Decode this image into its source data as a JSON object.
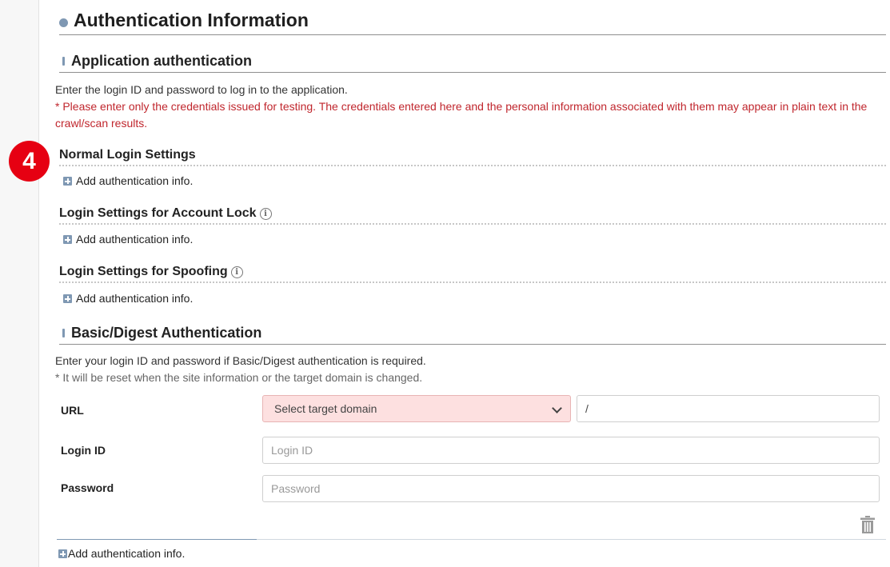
{
  "page": {
    "title": "Authentication Information",
    "step_badge": "4"
  },
  "app_auth": {
    "title": "Application authentication",
    "description": "Enter the login ID and password to log in to the application.",
    "warning": "* Please enter only the credentials issued for testing. The credentials entered here and the personal information associated with them may appear in plain text in the crawl/scan results.",
    "sections": [
      {
        "title": "Normal Login Settings",
        "add_label": "Add authentication info."
      },
      {
        "title": "Login Settings for Account Lock",
        "add_label": "Add authentication info."
      },
      {
        "title": "Login Settings for Spoofing",
        "add_label": "Add authentication info."
      }
    ]
  },
  "basic_auth": {
    "title": "Basic/Digest Authentication",
    "description": "Enter your login ID and password if Basic/Digest authentication is required.",
    "note": "* It will be reset when the site information or the target domain is changed.",
    "url_label": "URL",
    "domain_select_value": "Select target domain",
    "path_value": "/",
    "login_id_label": "Login ID",
    "login_id_placeholder": "Login ID",
    "password_label": "Password",
    "password_placeholder": "Password",
    "add_label": "Add authentication info."
  },
  "icons": {
    "bullet": "circle-bullet-icon",
    "section_marker": "bar-marker-icon",
    "add": "plus-square-icon",
    "info": "info-circle-icon",
    "dropdown": "chevron-down-icon",
    "delete": "trash-icon"
  },
  "colors": {
    "accent": "#7f98b3",
    "warning_text": "#c0262d",
    "badge": "#e60012",
    "select_bg": "#fde0e0"
  }
}
